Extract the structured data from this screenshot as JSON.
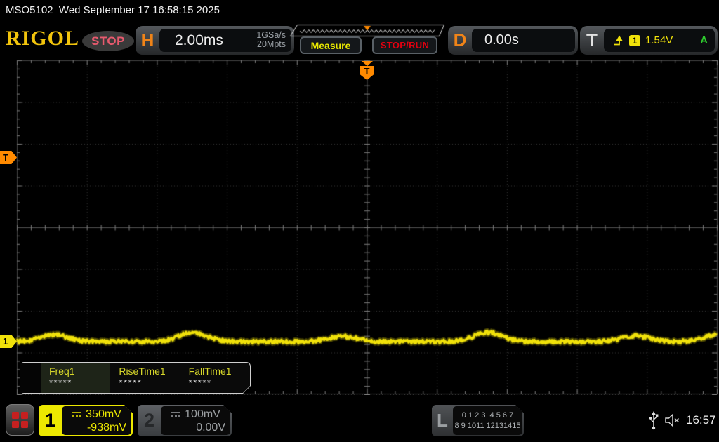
{
  "titlebar": {
    "model": "MSO5102",
    "datetime": "Wed September 17 16:58:15 2025"
  },
  "header": {
    "brand": "RIGOL",
    "acq_status": "STOP",
    "horizontal": {
      "label": "H",
      "timebase": "2.00ms",
      "sample_rate": "1GSa/s",
      "mem_depth": "20Mpts"
    },
    "buttons": {
      "measure": "Measure",
      "stop_run": "STOP/RUN"
    },
    "delay": {
      "label": "D",
      "value": "0.00s"
    },
    "trigger": {
      "label": "T",
      "source_channel": "1",
      "level": "1.54V",
      "mode": "A",
      "slope_icon": "rising-edge-icon"
    }
  },
  "markers": {
    "trigger_top_label": "T",
    "trigger_left_label": "T",
    "channel_left_label": "1"
  },
  "chart_data": {
    "type": "line",
    "title": "Oscilloscope channel 1 trace",
    "x_axis": {
      "timebase_per_div": "2.00ms",
      "divisions": 10,
      "delay": "0.00s",
      "minor_per_div": 5
    },
    "y_axis": {
      "volts_per_div": "350mV",
      "divisions": 8,
      "offset": "-938mV",
      "minor_per_div": 5
    },
    "grid": {
      "style": "dotted-major-with-center-crosshair",
      "legend": "none"
    },
    "trace": {
      "channel": "1",
      "color": "#f0e10a",
      "baseline_div_from_top": 6.74,
      "noise_div": 0.045,
      "bumps": [
        {
          "center_frac": 0.054,
          "amplitude_div": 0.16,
          "sigma_frac": 0.02
        },
        {
          "center_frac": 0.252,
          "amplitude_div": 0.22,
          "sigma_frac": 0.02
        },
        {
          "center_frac": 0.465,
          "amplitude_div": 0.13,
          "sigma_frac": 0.02
        },
        {
          "center_frac": 0.673,
          "amplitude_div": 0.22,
          "sigma_frac": 0.02
        },
        {
          "center_frac": 0.884,
          "amplitude_div": 0.14,
          "sigma_frac": 0.02
        },
        {
          "center_frac": 1.0,
          "amplitude_div": 0.16,
          "sigma_frac": 0.02
        }
      ]
    },
    "marker_positions": {
      "trigger_level_frac_y": 0.292,
      "trigger_pos_frac_x": 0.5,
      "channel1_frac_y": 0.843
    }
  },
  "measurements": {
    "items": [
      {
        "label": "Freq1",
        "value": "*****"
      },
      {
        "label": "RiseTime1",
        "value": "*****"
      },
      {
        "label": "FallTime1",
        "value": "*****"
      }
    ]
  },
  "bottombar": {
    "channel1": {
      "number": "1",
      "scale": "350mV",
      "offset": "-938mV",
      "coupling_icon": "dc-coupling-icon"
    },
    "channel2": {
      "number": "2",
      "scale": "100mV",
      "offset": "0.00V",
      "coupling_icon": "dc-coupling-icon"
    },
    "logic": {
      "label": "L",
      "row1": "0 1 2 3  4 5 6 7",
      "row2": "8 9 1011 12131415"
    },
    "status": {
      "time": "16:57",
      "usb_icon": "usb-icon",
      "mute_icon": "speaker-muted-icon"
    }
  },
  "colors": {
    "accent_orange": "#f08418",
    "marker_orange": "#ff8a00",
    "trace_yellow": "#f0e10a",
    "channel1_yellow": "#ece800",
    "run_red": "#e00010",
    "stop_pink": "#e85a6e",
    "trig_mode_green": "#2ecc2e",
    "grid_major": "#383838",
    "grid_center": "#525252",
    "grid_tick": "#7d7d7d",
    "grid_ruler": "#454545",
    "ribbon_line": "#e8e8e8"
  }
}
